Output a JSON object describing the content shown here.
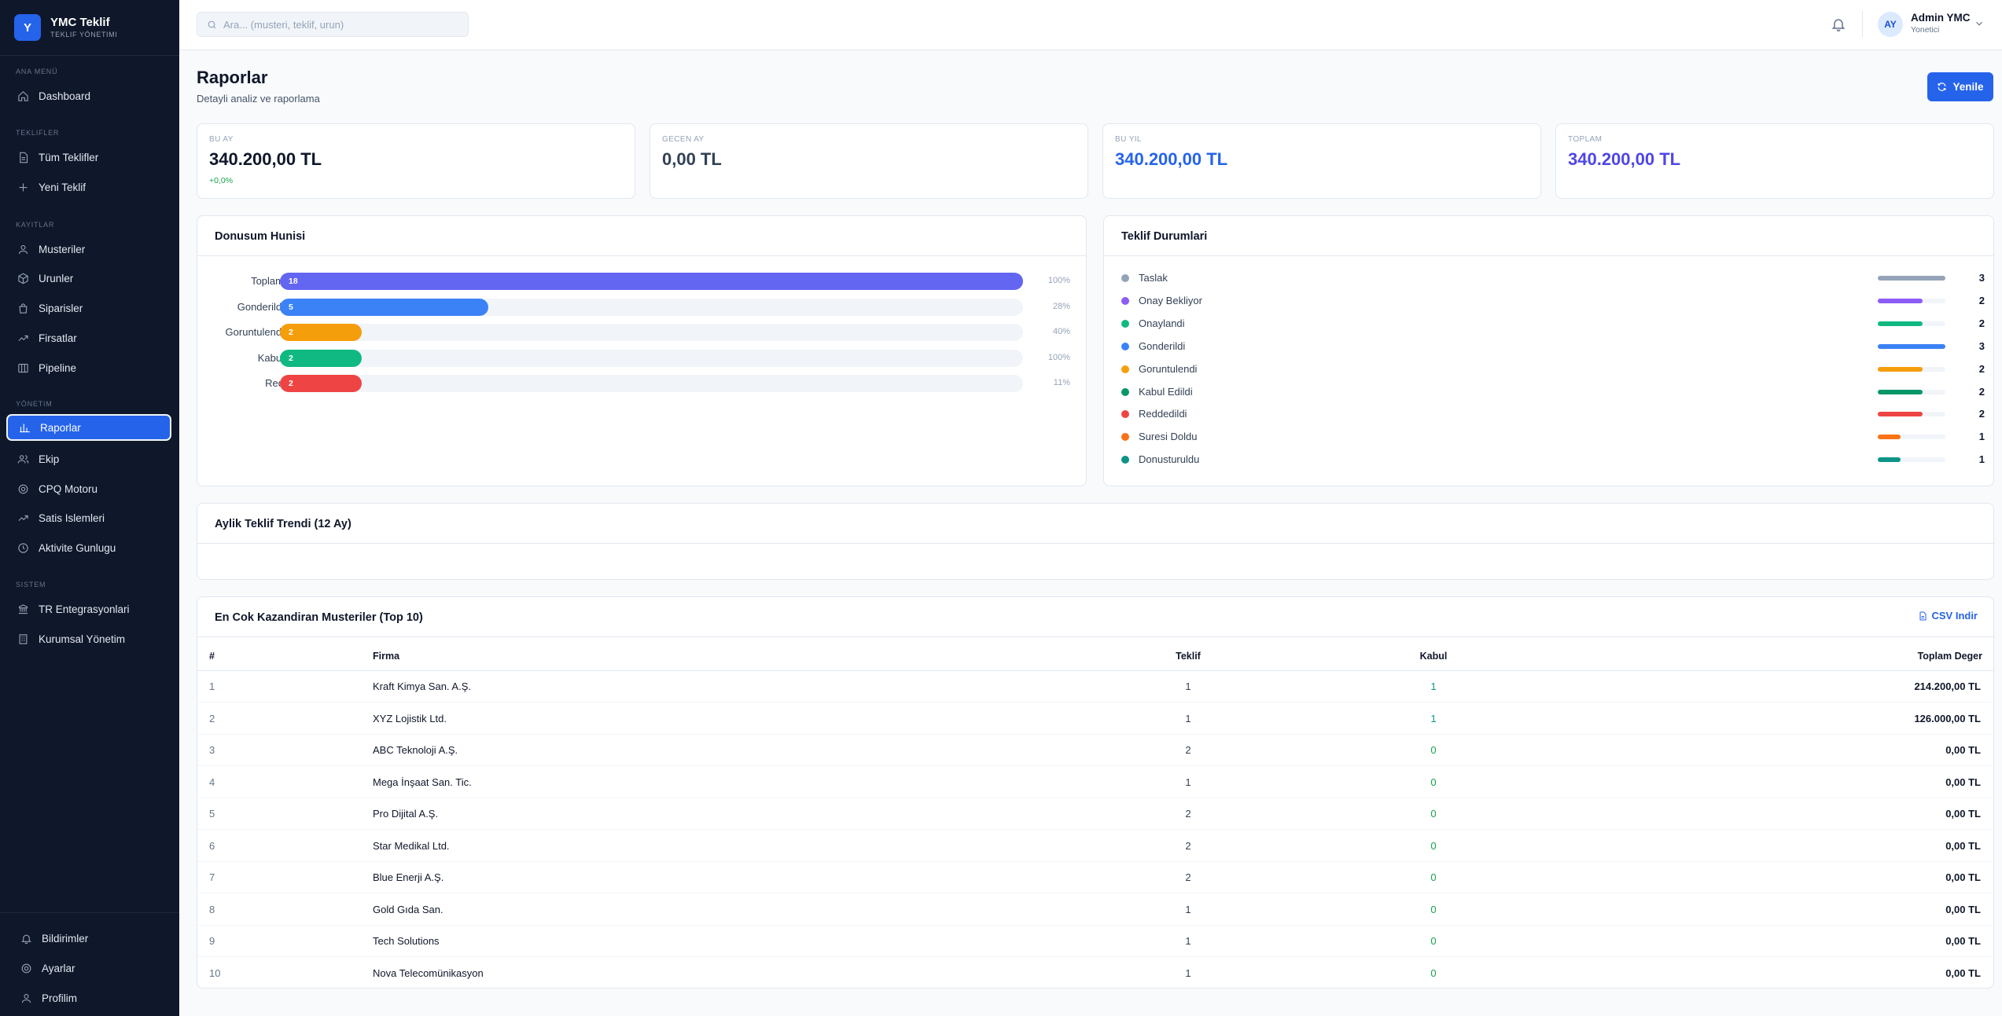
{
  "brand": {
    "logo": "Y",
    "title": "YMC Teklif",
    "subtitle": "TEKLIF YÖNETIMI"
  },
  "sidebar": {
    "sections": [
      {
        "label": "ANA MENÜ"
      },
      {
        "label": "TEKLIFLER"
      },
      {
        "label": "KAYITLAR"
      },
      {
        "label": "YÖNETIM"
      },
      {
        "label": "SISTEM"
      }
    ],
    "items": [
      {
        "label": "Dashboard",
        "icon": "home-icon"
      },
      {
        "label": "Tüm Teklifler",
        "icon": "document-icon"
      },
      {
        "label": "Yeni Teklif",
        "icon": "plus-icon"
      },
      {
        "label": "Musteriler",
        "icon": "users-icon"
      },
      {
        "label": "Urunler",
        "icon": "box-icon"
      },
      {
        "label": "Siparisler",
        "icon": "bag-icon"
      },
      {
        "label": "Firsatlar",
        "icon": "trending-icon"
      },
      {
        "label": "Pipeline",
        "icon": "columns-icon"
      },
      {
        "label": "Raporlar",
        "icon": "bar-chart-icon",
        "active": true
      },
      {
        "label": "Ekip",
        "icon": "team-icon"
      },
      {
        "label": "CPQ Motoru",
        "icon": "gear-icon"
      },
      {
        "label": "Satis Islemleri",
        "icon": "trending-icon"
      },
      {
        "label": "Aktivite Gunlugu",
        "icon": "clock-icon"
      },
      {
        "label": "TR Entegrasyonlari",
        "icon": "link-icon"
      },
      {
        "label": "Kurumsal Yönetim",
        "icon": "building-icon"
      }
    ],
    "bottom": [
      {
        "label": "Bildirimler",
        "icon": "bell-icon"
      },
      {
        "label": "Ayarlar",
        "icon": "gear-icon"
      },
      {
        "label": "Profilim",
        "icon": "user-icon"
      }
    ]
  },
  "header": {
    "search_placeholder": "Ara... (musteri, teklif, urun)",
    "user": {
      "initials": "AY",
      "name": "Admin YMC",
      "role": "Yonetici"
    }
  },
  "page": {
    "title": "Raporlar",
    "subtitle": "Detayli analiz ve raporlama",
    "refresh_label": "Yenile"
  },
  "stats": [
    {
      "label": "BU AY",
      "value": "340.200,00 TL",
      "delta": "+0,0%",
      "color": "#0f172a"
    },
    {
      "label": "GECEN AY",
      "value": "0,00 TL",
      "delta": "",
      "color": "#334155"
    },
    {
      "label": "BU YIL",
      "value": "340.200,00 TL",
      "delta": "",
      "color": "#2563eb"
    },
    {
      "label": "TOPLAM",
      "value": "340.200,00 TL",
      "delta": "",
      "color": "#4f46e5"
    }
  ],
  "funnel": {
    "title": "Donusum Hunisi",
    "rows": [
      {
        "label": "Toplam",
        "count": "18",
        "pct": "100%",
        "fill": 1.0,
        "color": "#6366f1"
      },
      {
        "label": "Gonderildi",
        "count": "5",
        "pct": "28%",
        "fill": 0.28,
        "color": "#3b82f6"
      },
      {
        "label": "Goruntulendi",
        "count": "2",
        "pct": "40%",
        "fill": 0.11,
        "color": "#f59e0b"
      },
      {
        "label": "Kabul",
        "count": "2",
        "pct": "100%",
        "fill": 0.11,
        "color": "#10b981"
      },
      {
        "label": "Red",
        "count": "2",
        "pct": "11%",
        "fill": 0.11,
        "color": "#ef4444"
      }
    ]
  },
  "statuses": {
    "title": "Teklif Durumlari",
    "rows": [
      {
        "label": "Taslak",
        "count": "3",
        "fill": 1.0,
        "color": "#94a3b8"
      },
      {
        "label": "Onay Bekliyor",
        "count": "2",
        "fill": 0.667,
        "color": "#8b5cf6"
      },
      {
        "label": "Onaylandi",
        "count": "2",
        "fill": 0.667,
        "color": "#10b981"
      },
      {
        "label": "Gonderildi",
        "count": "3",
        "fill": 1.0,
        "color": "#3b82f6"
      },
      {
        "label": "Goruntulendi",
        "count": "2",
        "fill": 0.667,
        "color": "#f59e0b"
      },
      {
        "label": "Kabul Edildi",
        "count": "2",
        "fill": 0.667,
        "color": "#059669"
      },
      {
        "label": "Reddedildi",
        "count": "2",
        "fill": 0.667,
        "color": "#ef4444"
      },
      {
        "label": "Suresi Doldu",
        "count": "1",
        "fill": 0.333,
        "color": "#f97316"
      },
      {
        "label": "Donusturuldu",
        "count": "1",
        "fill": 0.333,
        "color": "#0d9488"
      }
    ]
  },
  "trend": {
    "title": "Aylik Teklif Trendi (12 Ay)"
  },
  "top_customers": {
    "title": "En Cok Kazandiran Musteriler (Top 10)",
    "csv_label": "CSV Indir",
    "columns": [
      "#",
      "Firma",
      "Teklif",
      "Kabul",
      "Toplam Deger"
    ],
    "rows": [
      {
        "rank": "1",
        "firm": "Kraft Kimya San. A.Ş.",
        "offers": "1",
        "accepted": "1",
        "total": "214.200,00 TL"
      },
      {
        "rank": "2",
        "firm": "XYZ Lojistik Ltd.",
        "offers": "1",
        "accepted": "1",
        "total": "126.000,00 TL"
      },
      {
        "rank": "3",
        "firm": "ABC Teknoloji A.Ş.",
        "offers": "2",
        "accepted": "0",
        "total": "0,00 TL"
      },
      {
        "rank": "4",
        "firm": "Mega İnşaat San. Tic.",
        "offers": "1",
        "accepted": "0",
        "total": "0,00 TL"
      },
      {
        "rank": "5",
        "firm": "Pro Dijital A.Ş.",
        "offers": "2",
        "accepted": "0",
        "total": "0,00 TL"
      },
      {
        "rank": "6",
        "firm": "Star Medikal Ltd.",
        "offers": "2",
        "accepted": "0",
        "total": "0,00 TL"
      },
      {
        "rank": "7",
        "firm": "Blue Enerji A.Ş.",
        "offers": "2",
        "accepted": "0",
        "total": "0,00 TL"
      },
      {
        "rank": "8",
        "firm": "Gold Gıda San.",
        "offers": "1",
        "accepted": "0",
        "total": "0,00 TL"
      },
      {
        "rank": "9",
        "firm": "Tech Solutions",
        "offers": "1",
        "accepted": "0",
        "total": "0,00 TL"
      },
      {
        "rank": "10",
        "firm": "Nova Telecomünikasyon",
        "offers": "1",
        "accepted": "0",
        "total": "0,00 TL"
      }
    ]
  }
}
